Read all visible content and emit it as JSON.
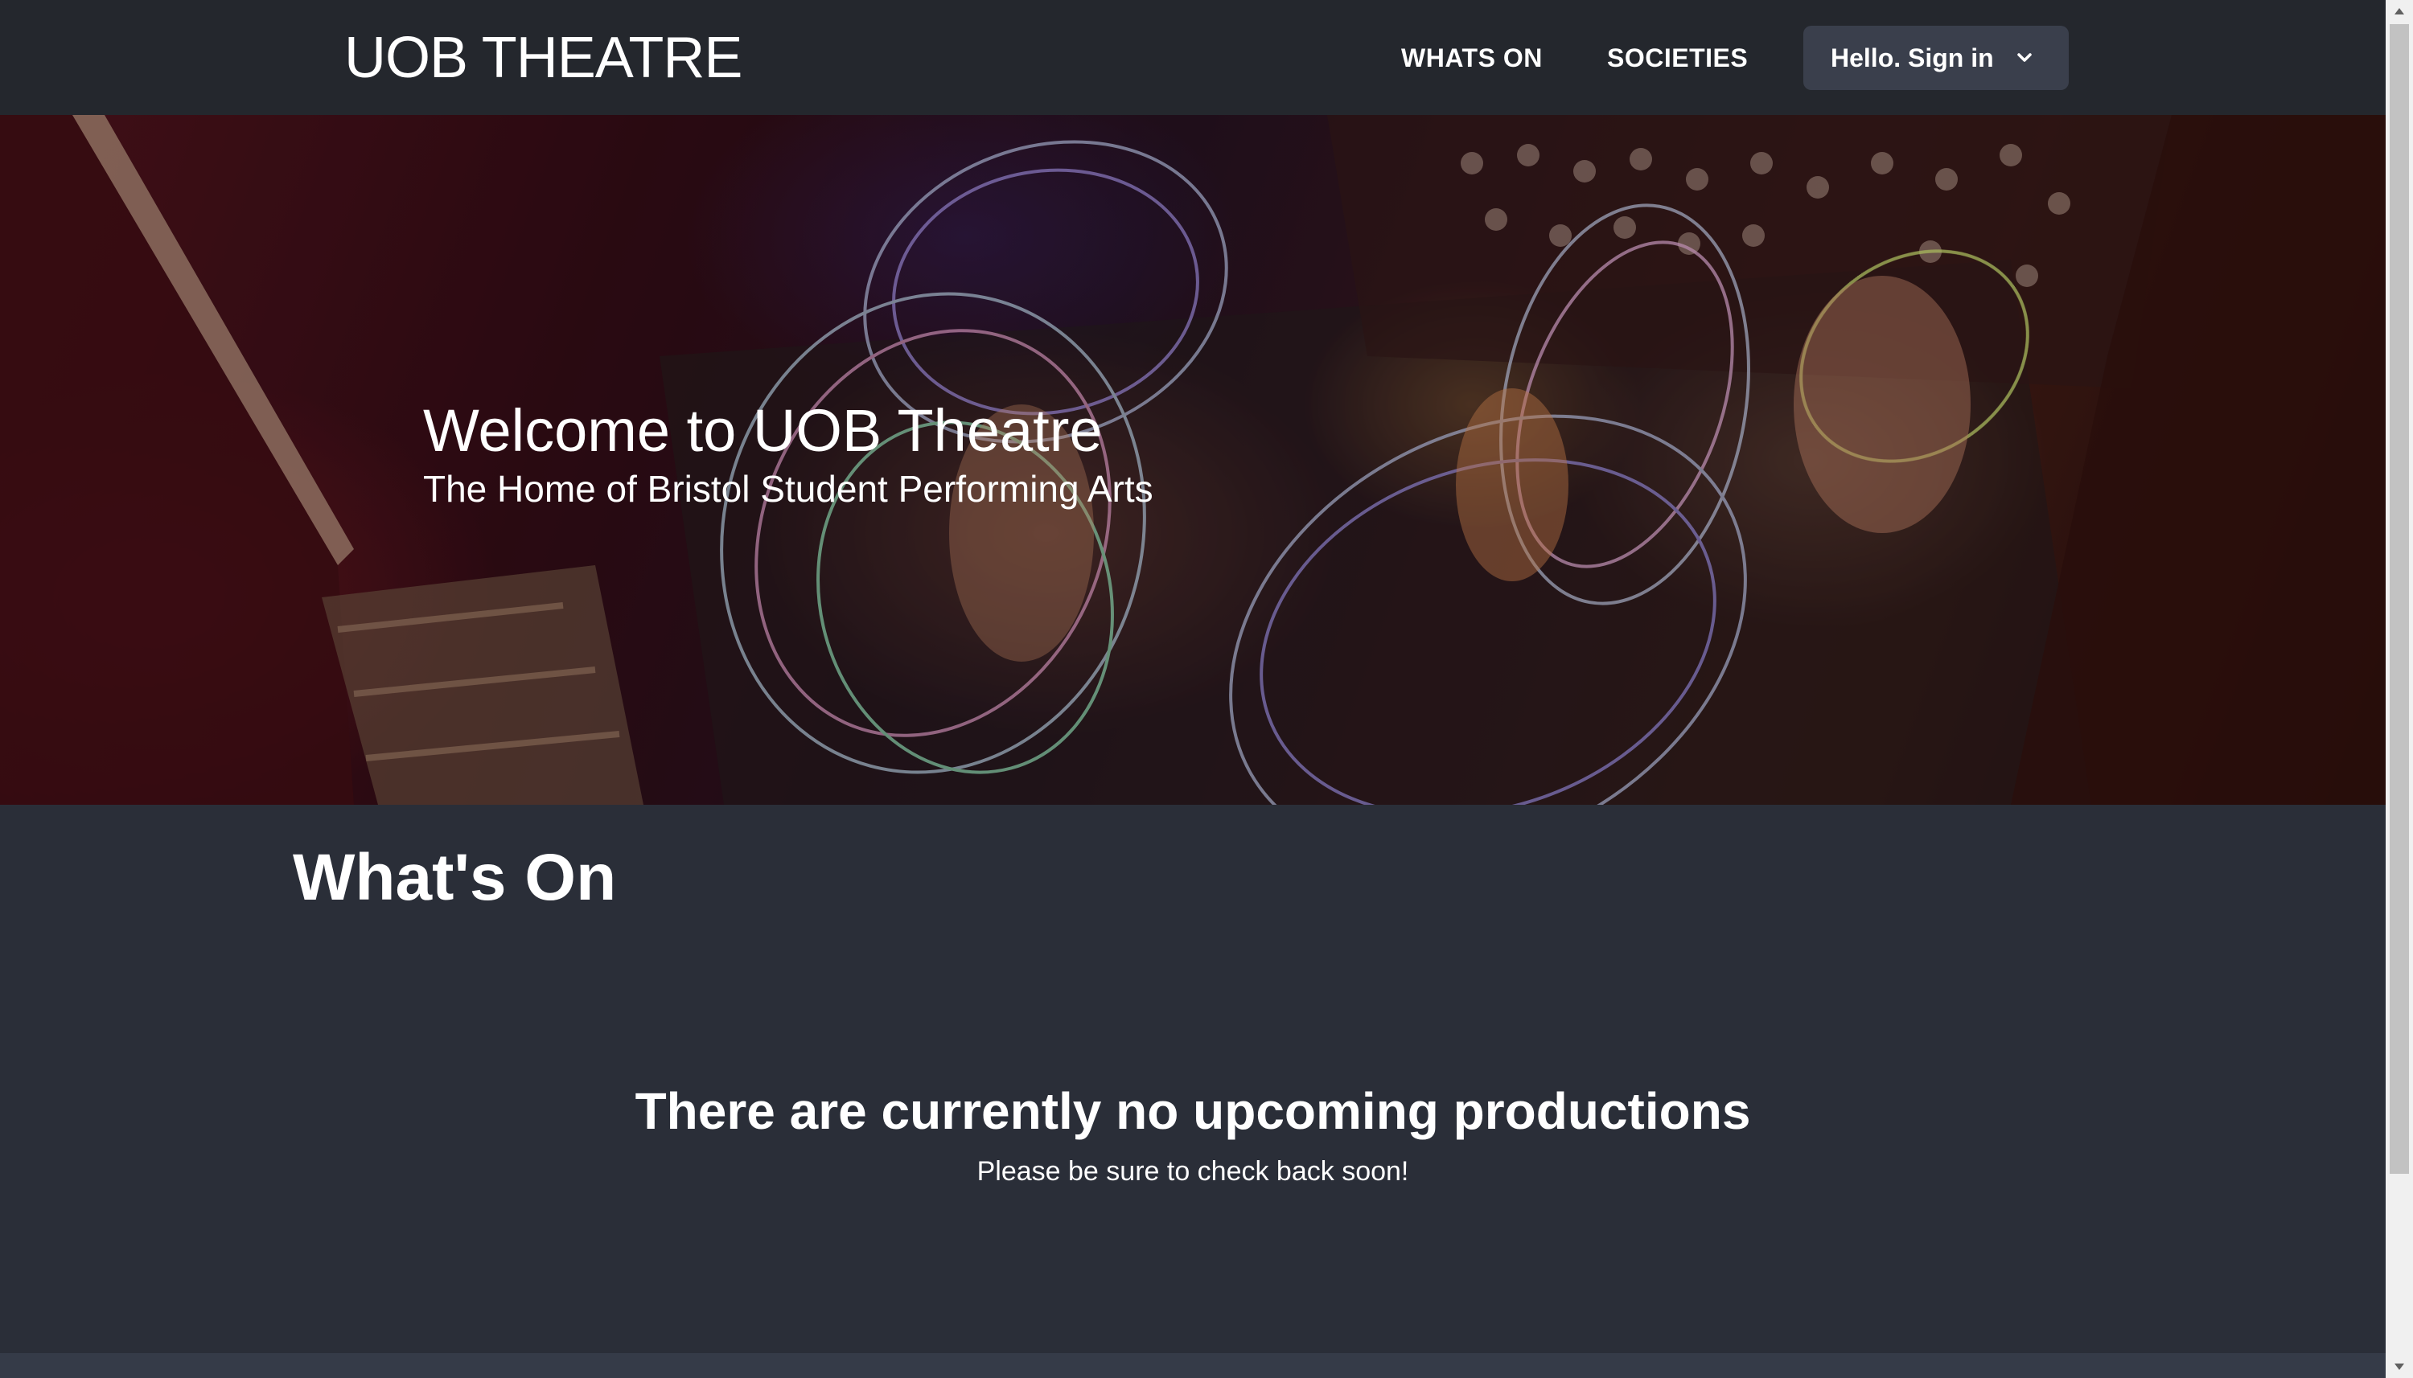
{
  "navbar": {
    "brand": "UOB THEATRE",
    "links": [
      {
        "label": "WHATS ON"
      },
      {
        "label": "SOCIETIES"
      }
    ],
    "signin_label": "Hello. Sign in",
    "chevron_icon": "chevron-down-icon"
  },
  "hero": {
    "title": "Welcome to UOB Theatre",
    "subtitle": "The Home of Bristol Student Performing Arts"
  },
  "main": {
    "heading": "What's On",
    "empty_title": "There are currently no upcoming productions",
    "empty_subtitle": "Please be sure to check back soon!"
  },
  "colors": {
    "navbar_bg": "#24272d",
    "page_bg": "#2a2e38",
    "button_bg": "#3a3f4c",
    "text": "#ffffff"
  }
}
